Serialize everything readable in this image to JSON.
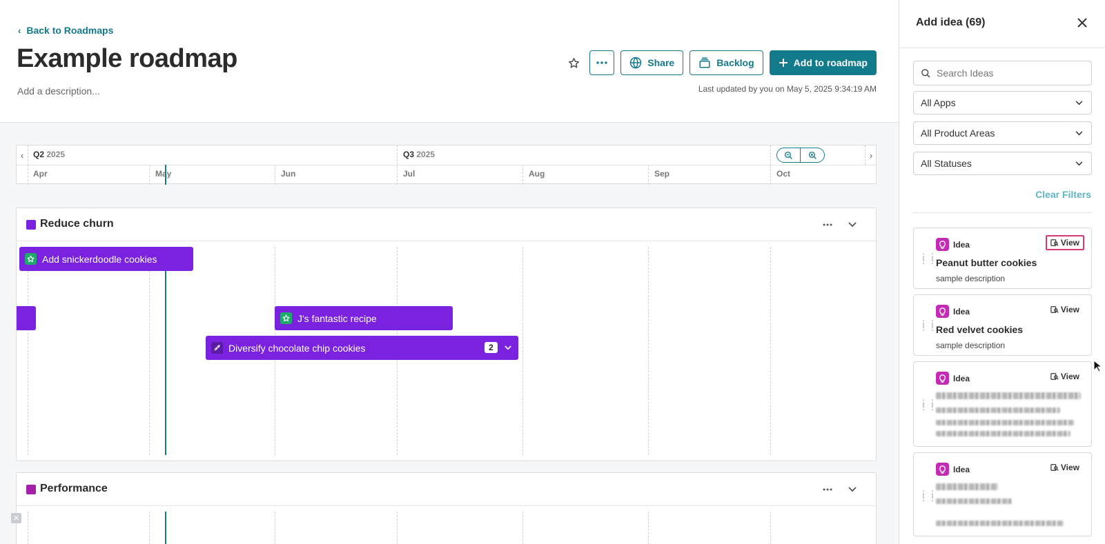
{
  "header": {
    "back_link": "Back to Roadmaps",
    "title": "Example roadmap",
    "description_placeholder": "Add a description...",
    "last_updated": "Last updated by you on May 5, 2025 9:34:19 AM",
    "share_label": "Share",
    "backlog_label": "Backlog",
    "add_label": "Add to roadmap"
  },
  "timeline": {
    "quarters": [
      {
        "name": "Q2",
        "year": "2025"
      },
      {
        "name": "Q3",
        "year": "2025"
      }
    ],
    "months": [
      "Apr",
      "May",
      "Jun",
      "Jul",
      "Aug",
      "Sep",
      "Oct"
    ]
  },
  "sections": [
    {
      "title": "Reduce churn",
      "color": "#7a22e0",
      "bars": [
        {
          "label": "Add snickerdoodle cookies",
          "icon": "star-icon"
        },
        {
          "label": "",
          "icon": ""
        },
        {
          "label": "J's fantastic recipe",
          "icon": "star-icon"
        },
        {
          "label": "Diversify chocolate chip cookies",
          "icon": "rocket-icon",
          "count": "2"
        }
      ]
    },
    {
      "title": "Performance",
      "color": "#a51fa8",
      "bars": []
    }
  ],
  "panel": {
    "title": "Add idea (69)",
    "search_placeholder": "Search Ideas",
    "filters": [
      "All Apps",
      "All Product Areas",
      "All Statuses"
    ],
    "clear_filters": "Clear Filters",
    "cards": [
      {
        "type": "Idea",
        "view": "View",
        "title": "Peanut butter cookies",
        "description": "sample description"
      },
      {
        "type": "Idea",
        "view": "View",
        "title": "Red velvet cookies",
        "description": "sample description"
      },
      {
        "type": "Idea",
        "view": "View"
      },
      {
        "type": "Idea",
        "view": "View"
      }
    ]
  },
  "colors": {
    "accent": "#137a8c",
    "bar": "#7a22e0",
    "idea_icon": "#c42bb4",
    "focus_ring": "#e0366b"
  }
}
